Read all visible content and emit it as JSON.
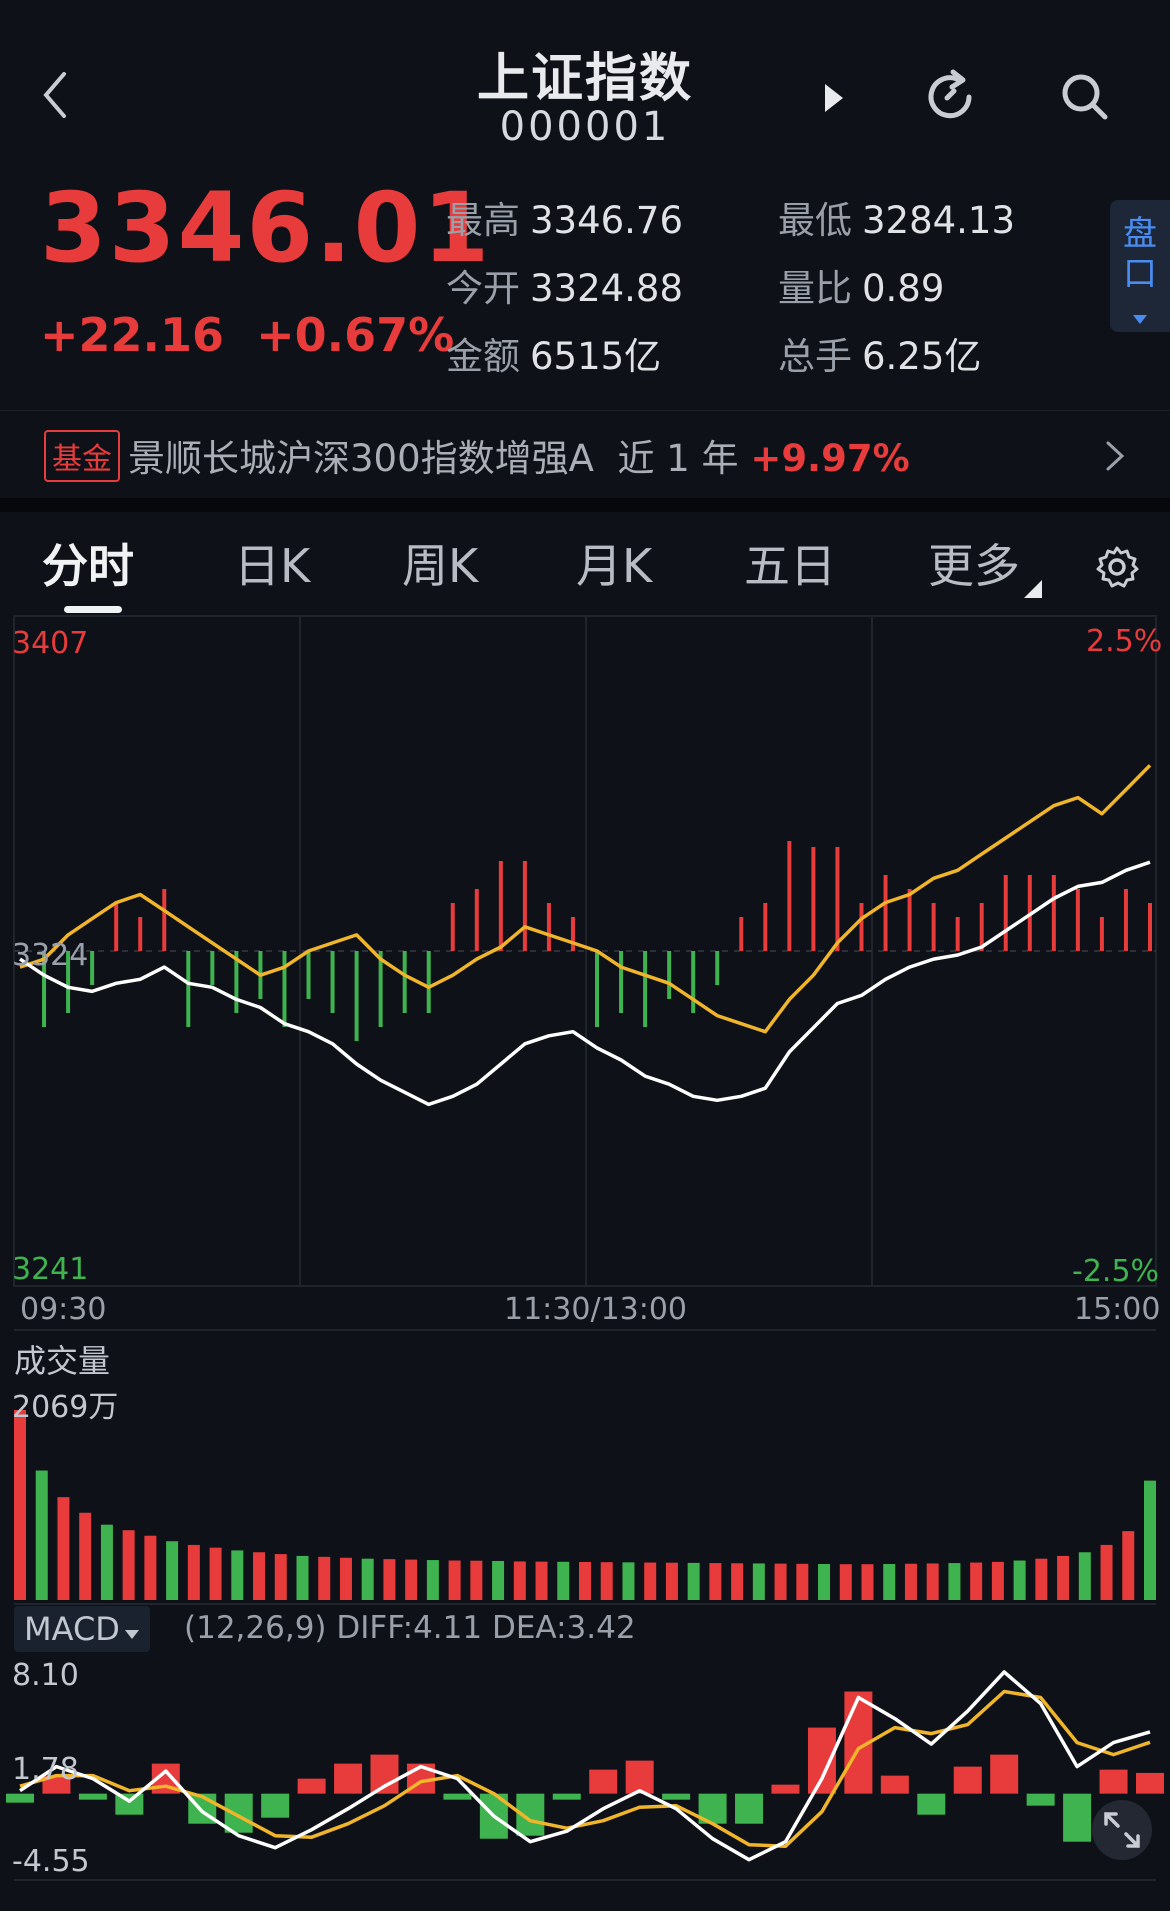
{
  "header": {
    "title": "上证指数",
    "code": "000001"
  },
  "quote": {
    "price": "3346.01",
    "change": "+22.16",
    "change_pct": "+0.67%",
    "stats": [
      {
        "label": "最高",
        "value": "3346.76"
      },
      {
        "label": "最低",
        "value": "3284.13"
      },
      {
        "label": "今开",
        "value": "3324.88"
      },
      {
        "label": "量比",
        "value": "0.89"
      },
      {
        "label": "金额",
        "value": "6515亿"
      },
      {
        "label": "总手",
        "value": "6.25亿"
      }
    ],
    "side_tab": [
      "盘",
      "口"
    ]
  },
  "fund": {
    "tag": "基金",
    "name": "景顺长城沪深300指数增强A",
    "period": "近 1 年",
    "return": "+9.97%"
  },
  "tabs": [
    "分时",
    "日K",
    "周K",
    "月K",
    "五日",
    "更多"
  ],
  "colors": {
    "up": "#e83b3b",
    "down": "#3fb34f",
    "price_line": "#ffffff",
    "avg_line": "#f0b52a",
    "background": "#0e1117"
  },
  "chart_data": [
    {
      "type": "line",
      "ylim": [
        3241,
        3407
      ],
      "y_tick_labels": [
        "3407",
        "3324",
        "3241"
      ],
      "y_pct_labels": [
        "2.5%",
        "-2.5%"
      ],
      "x_tick_labels": [
        "09:30",
        "11:30/13:00",
        "15:00"
      ],
      "series": [
        {
          "values": [
            3322,
            3318,
            3315,
            3314,
            3316,
            3317,
            3320,
            3316,
            3315,
            3312,
            3310,
            3306,
            3304,
            3301,
            3296,
            3292,
            3289,
            3286,
            3288,
            3291,
            3296,
            3301,
            3303,
            3304,
            3300,
            3297,
            3293,
            3291,
            3288,
            3287,
            3288,
            3290,
            3299,
            3305,
            3311,
            3313,
            3317,
            3320,
            3322,
            3323,
            3325,
            3329,
            3333,
            3337,
            3340,
            3341,
            3344,
            3346
          ]
        },
        {
          "values": [
            3320,
            3322,
            3328,
            3332,
            3336,
            3338,
            3334,
            3330,
            3326,
            3322,
            3318,
            3320,
            3324,
            3326,
            3328,
            3322,
            3318,
            3315,
            3318,
            3322,
            3325,
            3330,
            3328,
            3326,
            3324,
            3320,
            3318,
            3316,
            3312,
            3308,
            3306,
            3304,
            3312,
            3318,
            3326,
            3332,
            3336,
            3338,
            3342,
            3344,
            3348,
            3352,
            3356,
            3360,
            3362,
            3358,
            3364,
            3370
          ]
        }
      ]
    },
    {
      "type": "bar",
      "title": "成交量",
      "y_tick_labels": [
        "2069万"
      ],
      "values": [
        2069,
        1410,
        1120,
        950,
        820,
        760,
        700,
        640,
        600,
        570,
        540,
        520,
        500,
        480,
        470,
        460,
        450,
        445,
        440,
        435,
        430,
        428,
        425,
        420,
        418,
        416,
        414,
        412,
        410,
        408,
        406,
        404,
        402,
        400,
        398,
        396,
        394,
        392,
        390,
        390,
        392,
        395,
        398,
        402,
        408,
        415,
        430,
        450,
        480,
        520,
        600,
        750,
        1300
      ]
    },
    {
      "type": "line",
      "title": "MACD",
      "subtitle": "(12,26,9) DIFF:4.11 DEA:3.42",
      "ylim": [
        -4.55,
        8.1
      ],
      "y_tick_labels": [
        "8.10",
        "1.78",
        "-4.55"
      ],
      "series": [
        {
          "name": "DIFF",
          "values": [
            0.2,
            1.8,
            1.0,
            -0.5,
            1.5,
            -1.2,
            -2.8,
            -3.6,
            -2.4,
            -1.0,
            0.5,
            1.8,
            1.0,
            -1.5,
            -3.2,
            -2.5,
            -1.0,
            0.2,
            -1.0,
            -3.0,
            -4.4,
            -3.2,
            1.0,
            6.4,
            5.0,
            3.3,
            5.5,
            8.1,
            6.0,
            1.8,
            3.4,
            4.11
          ]
        },
        {
          "name": "DEA",
          "values": [
            0.5,
            1.2,
            1.2,
            0.2,
            0.5,
            -0.2,
            -1.5,
            -2.8,
            -2.9,
            -2.0,
            -0.8,
            0.8,
            1.2,
            0.0,
            -1.8,
            -2.3,
            -1.8,
            -0.9,
            -0.8,
            -2.0,
            -3.4,
            -3.5,
            -1.2,
            3.0,
            4.4,
            4.0,
            4.6,
            6.8,
            6.4,
            3.4,
            2.6,
            3.42
          ]
        }
      ]
    }
  ]
}
